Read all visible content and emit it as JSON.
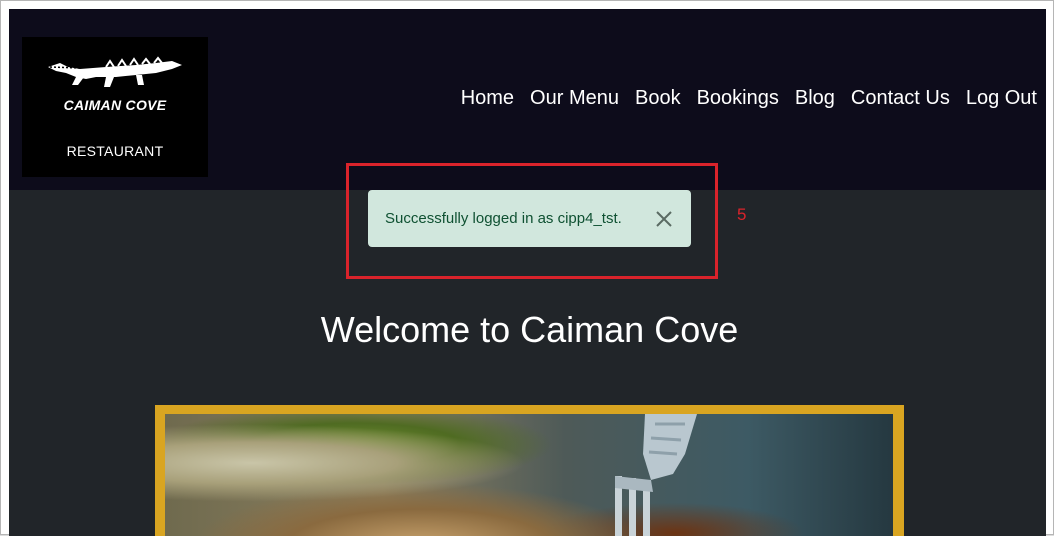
{
  "logo": {
    "title": "CAIMAN COVE",
    "subtitle": "RESTAURANT",
    "icon": "caiman-icon"
  },
  "nav": {
    "items": [
      "Home",
      "Our Menu",
      "Book",
      "Bookings",
      "Blog",
      "Contact Us",
      "Log Out"
    ]
  },
  "alert": {
    "message": "Successfully logged in as cipp4_tst.",
    "close_icon": "close-icon",
    "color_bg": "#d1e7dd",
    "color_text": "#0f5132"
  },
  "annotation": {
    "number": "5",
    "color": "#d9232b"
  },
  "main": {
    "heading": "Welcome to Caiman Cove"
  },
  "hero": {
    "frame_color": "#d9a521",
    "image_icon": "food-photo"
  }
}
